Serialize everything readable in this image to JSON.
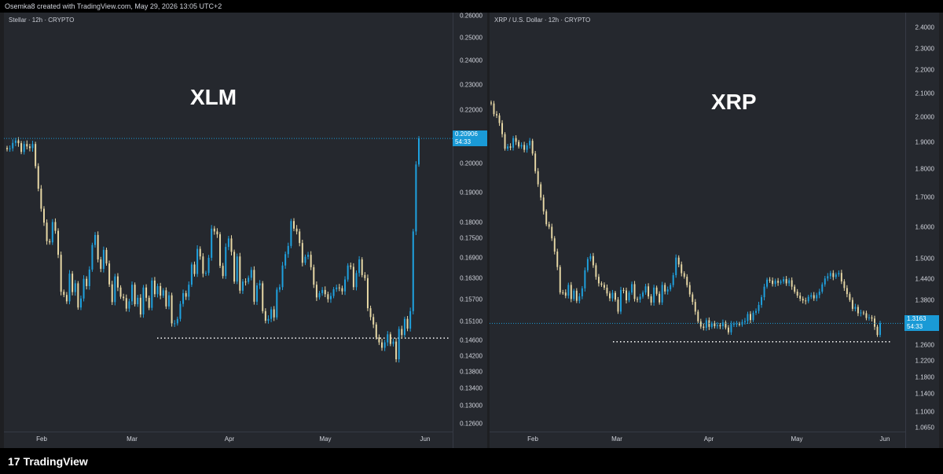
{
  "header": {
    "credit": "Osemka8 created with TradingView.com, May 29, 2026 13:05 UTC+2"
  },
  "footer": {
    "brand": "TradingView",
    "brand_mark": "17"
  },
  "colors": {
    "up": "#1fa2e0",
    "down": "#e8d9a6",
    "price_line": "#1a9ad6",
    "support": "#ffffff"
  },
  "chart_data": [
    {
      "type": "candlestick",
      "title": "Stellar · 12h · CRYPTO",
      "label": "XLM",
      "y_scale": "log",
      "y_ticks": [
        "0.26000",
        "0.25000",
        "0.24000",
        "0.23000",
        "0.22000",
        "0.21000",
        "0.20000",
        "0.19000",
        "0.18000",
        "0.17500",
        "0.16900",
        "0.16300",
        "0.15700",
        "0.15100",
        "0.14600",
        "0.14200",
        "0.13800",
        "0.13400",
        "0.13000",
        "0.12600"
      ],
      "x_ticks": [
        "Feb",
        "Mar",
        "Apr",
        "May",
        "Jun"
      ],
      "last_price": "0.20906",
      "countdown": "54:33",
      "support_level": 0.1466,
      "close_series": [
        0.2051,
        0.2054,
        0.2074,
        0.2083,
        0.2073,
        0.2041,
        0.207,
        0.2061,
        0.2055,
        0.207,
        0.199,
        0.1912,
        0.1845,
        0.18,
        0.1742,
        0.1738,
        0.1802,
        0.1774,
        0.17,
        0.1592,
        0.1583,
        0.1565,
        0.1644,
        0.1591,
        0.1616,
        0.1548,
        0.1573,
        0.1629,
        0.1608,
        0.1656,
        0.173,
        0.1761,
        0.1686,
        0.1658,
        0.1715,
        0.1674,
        0.1613,
        0.1563,
        0.1636,
        0.1604,
        0.1578,
        0.1574,
        0.1545,
        0.1565,
        0.1612,
        0.1557,
        0.1575,
        0.1529,
        0.1604,
        0.1575,
        0.1547,
        0.1624,
        0.1585,
        0.1608,
        0.1581,
        0.1596,
        0.1551,
        0.1582,
        0.1505,
        0.1505,
        0.1517,
        0.1558,
        0.1588,
        0.1578,
        0.1612,
        0.1671,
        0.1643,
        0.1718,
        0.1695,
        0.1644,
        0.1646,
        0.1691,
        0.1781,
        0.1772,
        0.1763,
        0.1667,
        0.1637,
        0.1724,
        0.175,
        0.1709,
        0.1621,
        0.1695,
        0.1595,
        0.1621,
        0.162,
        0.1632,
        0.1655,
        0.1564,
        0.161,
        0.1616,
        0.1538,
        0.1512,
        0.1517,
        0.1543,
        0.1521,
        0.1598,
        0.1605,
        0.1668,
        0.1702,
        0.1727,
        0.1805,
        0.1781,
        0.1772,
        0.1736,
        0.1676,
        0.1694,
        0.17,
        0.1663,
        0.1612,
        0.1576,
        0.1588,
        0.1597,
        0.1585,
        0.1571,
        0.158,
        0.1599,
        0.1604,
        0.1602,
        0.1593,
        0.1627,
        0.1668,
        0.1664,
        0.1605,
        0.1646,
        0.1686,
        0.164,
        0.1631,
        0.1546,
        0.1522,
        0.1502,
        0.1468,
        0.1455,
        0.1441,
        0.1455,
        0.1476,
        0.1451,
        0.1457,
        0.1412,
        0.149,
        0.1474,
        0.1517,
        0.1491,
        0.1538,
        0.1772,
        0.1996,
        0.2091
      ]
    },
    {
      "type": "candlestick",
      "title": "XRP / U.S. Dollar · 12h · CRYPTO",
      "label": "XRP",
      "y_scale": "log",
      "y_ticks": [
        "2.4000",
        "2.3000",
        "2.2000",
        "2.1000",
        "2.0000",
        "1.9000",
        "1.8000",
        "1.7000",
        "1.6000",
        "1.5000",
        "1.4400",
        "1.3800",
        "1.3163",
        "1.2600",
        "1.2200",
        "1.1800",
        "1.1400",
        "1.1000",
        "1.0650"
      ],
      "x_ticks": [
        "Feb",
        "Mar",
        "Apr",
        "May",
        "Jun"
      ],
      "last_price": "1.3163",
      "countdown": "54:33",
      "support_level": 1.268,
      "close_series": [
        2.0567,
        2.0126,
        2.0075,
        1.9767,
        1.9326,
        1.8765,
        1.8851,
        1.8801,
        1.9171,
        1.9027,
        1.8846,
        1.8908,
        1.8721,
        1.8891,
        1.9067,
        1.858,
        1.7925,
        1.7455,
        1.6993,
        1.6523,
        1.6097,
        1.6012,
        1.5641,
        1.5227,
        1.4757,
        1.4015,
        1.4013,
        1.3924,
        1.4231,
        1.3829,
        1.4064,
        1.3779,
        1.3905,
        1.4132,
        1.4659,
        1.4998,
        1.5088,
        1.481,
        1.4466,
        1.4277,
        1.4231,
        1.4151,
        1.3986,
        1.3848,
        1.4004,
        1.3812,
        1.348,
        1.4085,
        1.4071,
        1.3793,
        1.4011,
        1.4253,
        1.383,
        1.3816,
        1.3896,
        1.4014,
        1.4189,
        1.3903,
        1.373,
        1.4154,
        1.3976,
        1.3734,
        1.423,
        1.4043,
        1.4102,
        1.4227,
        1.4515,
        1.5042,
        1.4836,
        1.4573,
        1.4469,
        1.4225,
        1.396,
        1.3748,
        1.348,
        1.3216,
        1.3076,
        1.3043,
        1.3245,
        1.3069,
        1.3161,
        1.3087,
        1.3112,
        1.3086,
        1.3188,
        1.3051,
        1.2925,
        1.3143,
        1.3148,
        1.3151,
        1.3133,
        1.3198,
        1.3224,
        1.3415,
        1.3251,
        1.3449,
        1.3497,
        1.3664,
        1.388,
        1.418,
        1.4383,
        1.4357,
        1.4258,
        1.4348,
        1.4294,
        1.4327,
        1.4399,
        1.4276,
        1.4366,
        1.4181,
        1.4037,
        1.3925,
        1.3838,
        1.3787,
        1.3765,
        1.3893,
        1.3937,
        1.3848,
        1.3941,
        1.4038,
        1.4246,
        1.4418,
        1.4485,
        1.4578,
        1.446,
        1.4536,
        1.4581,
        1.4331,
        1.4141,
        1.3968,
        1.3803,
        1.3556,
        1.3609,
        1.3435,
        1.3455,
        1.3436,
        1.3305,
        1.3323,
        1.329,
        1.3072,
        1.2856,
        1.3163
      ]
    }
  ]
}
